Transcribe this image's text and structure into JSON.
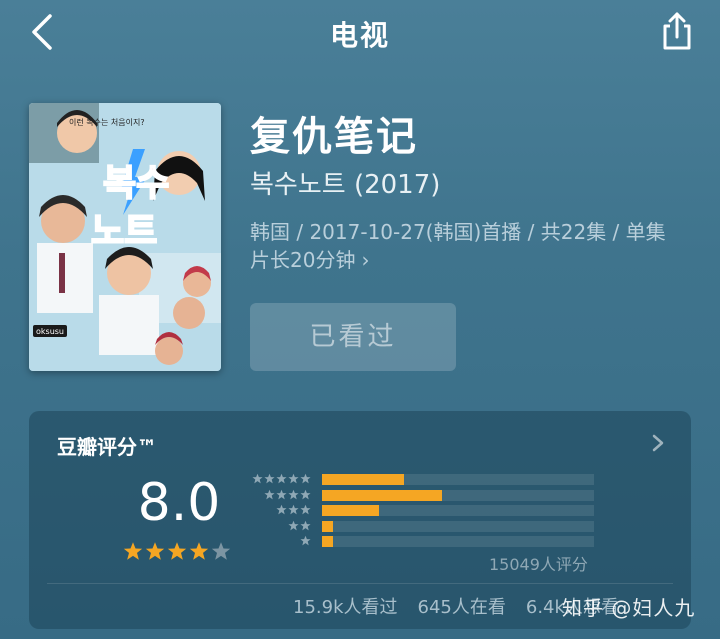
{
  "header": {
    "title": "电视"
  },
  "show": {
    "title": "复仇笔记",
    "original_title": "복수노트 (2017)",
    "meta_line1": "韩国 / 2017-10-27(韩国)首播 / 共22集 / 单集",
    "meta_line2": "片长20分钟",
    "watched_label": "已看过"
  },
  "poster": {
    "title_text_line1": "복수",
    "title_text_line2": "노트",
    "tagline": "이런 복수는 처음이지?",
    "brand": "oksusu"
  },
  "rating": {
    "label": "豆瓣评分™",
    "score": "8.0",
    "stars_filled": 4,
    "stars_total": 5,
    "distribution_fractions": [
      0.3,
      0.44,
      0.21,
      0.04,
      0.04
    ],
    "votes_text": "15049人评分",
    "counts": [
      "15.9k人看过",
      "645人在看",
      "6.4k人想看"
    ]
  },
  "colors": {
    "accent": "#f5a623",
    "star_empty": "#7c95a3"
  },
  "watermark": "知乎 @妇人九"
}
